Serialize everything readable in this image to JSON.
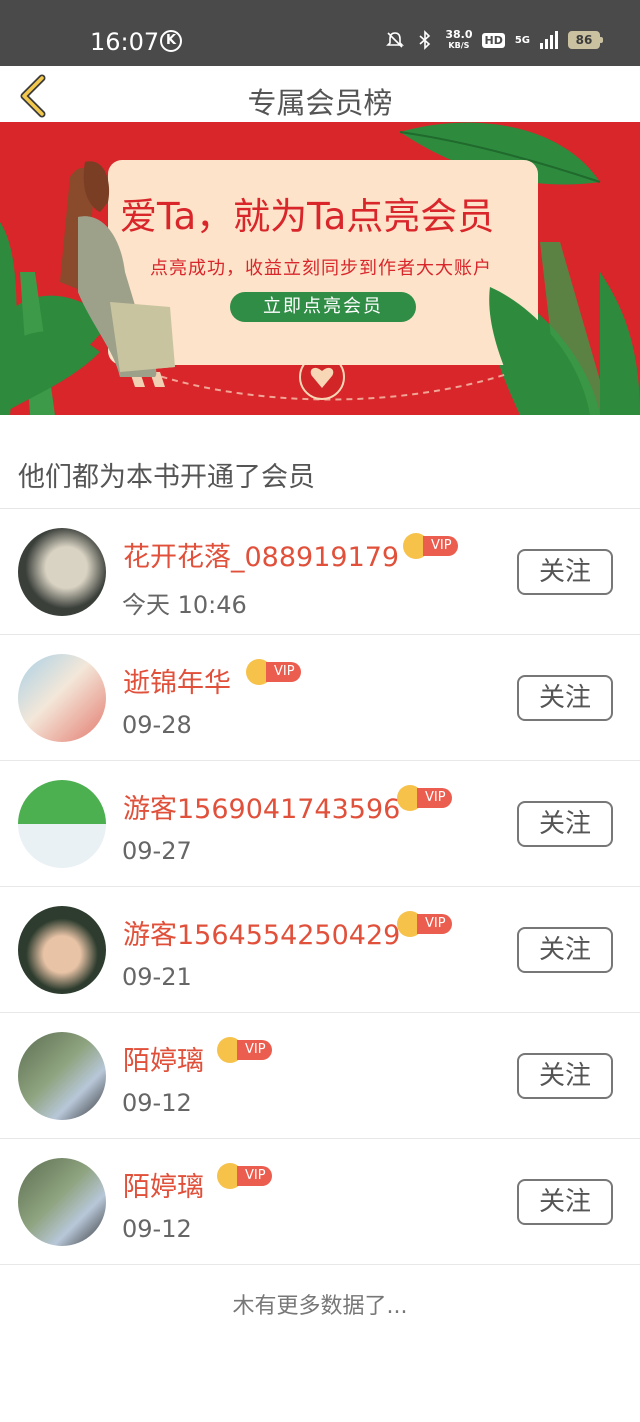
{
  "status_bar": {
    "time": "16:07",
    "k_label": "K",
    "speed_value": "38.0",
    "speed_unit": "KB/S",
    "hd_label": "HD",
    "network_label": "5G",
    "battery": "86",
    "icons": [
      "mute-bell-icon",
      "bluetooth-icon",
      "signal-icon"
    ]
  },
  "nav": {
    "title": "专属会员榜",
    "back_icon": "chevron-left-icon"
  },
  "banner": {
    "title": "爱Ta，就为Ta点亮会员",
    "subtitle": "点亮成功，收益立刻同步到作者大大账户",
    "button_label": "立即点亮会员",
    "colors": {
      "background": "#d8262a",
      "card": "#fce3c9",
      "button": "#2f8d46",
      "leaf": "#2e8b3e"
    }
  },
  "section": {
    "title": "他们都为本书开通了会员"
  },
  "members": [
    {
      "name": "花开花落_088919179",
      "vip": "VIP",
      "time": "今天 10:46",
      "follow": "关注",
      "avatar_colors": [
        "#3a3f3a",
        "#c9c4b5"
      ]
    },
    {
      "name": "逝锦年华",
      "vip": "VIP",
      "time": "09-28",
      "follow": "关注",
      "avatar_colors": [
        "#a8d0e6",
        "#e37a6e"
      ]
    },
    {
      "name": "游客1569041743596",
      "vip": "VIP",
      "time": "09-27",
      "follow": "关注",
      "avatar_colors": [
        "#4caf50",
        "#e9f1f4"
      ]
    },
    {
      "name": "游客1564554250429",
      "vip": "VIP",
      "time": "09-21",
      "follow": "关注",
      "avatar_colors": [
        "#2d3c2e",
        "#e8c3a6"
      ]
    },
    {
      "name": "陌婷璃",
      "vip": "VIP",
      "time": "09-12",
      "follow": "关注",
      "avatar_colors": [
        "#5c6e52",
        "#b8c7d8"
      ]
    },
    {
      "name": "陌婷璃",
      "vip": "VIP",
      "time": "09-12",
      "follow": "关注",
      "avatar_colors": [
        "#5c6e52",
        "#b8c7d8"
      ]
    }
  ],
  "footer": {
    "text": "木有更多数据了..."
  }
}
